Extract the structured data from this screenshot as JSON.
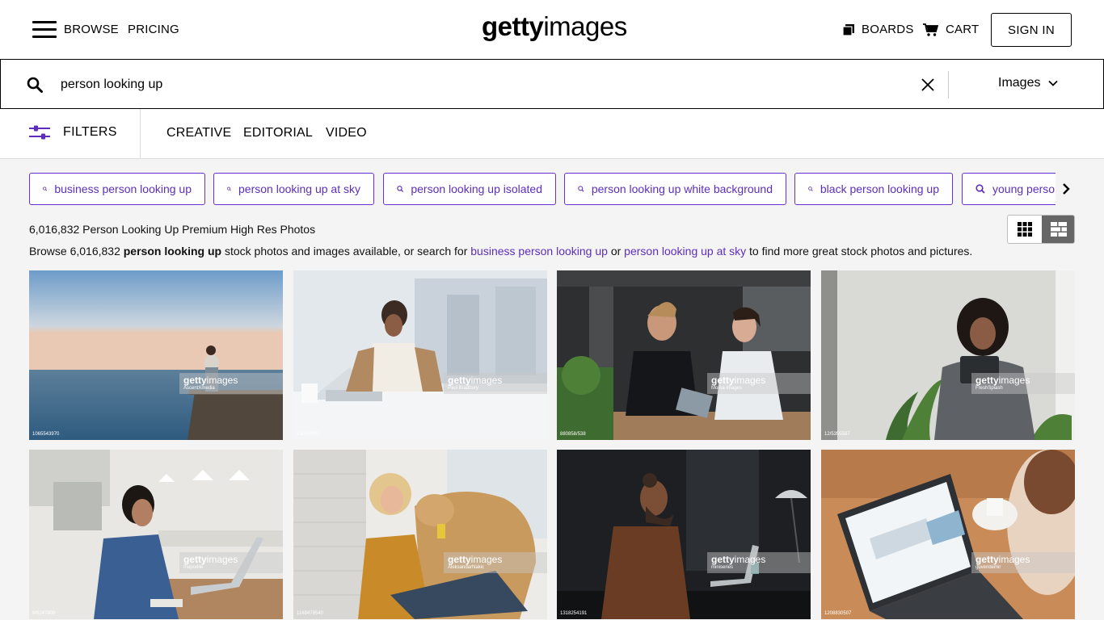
{
  "header": {
    "browse_label": "BROWSE",
    "pricing_label": "PRICING",
    "logo_bold": "getty",
    "logo_light": "images",
    "boards_label": "BOARDS",
    "cart_label": "CART",
    "signin_label": "SIGN IN"
  },
  "search": {
    "query": "person looking up",
    "media_type": "Images"
  },
  "filters": {
    "filters_label": "FILTERS",
    "tabs": [
      "CREATIVE",
      "EDITORIAL",
      "VIDEO"
    ]
  },
  "related_searches": [
    "business person looking up",
    "person looking up at sky",
    "person looking up isolated",
    "person looking up white background",
    "black person looking up",
    "young person looking up"
  ],
  "results": {
    "count_text": "6,016,832 Person Looking Up Premium High Res Photos",
    "browse_prefix": "Browse 6,016,832 ",
    "browse_query": "person looking up",
    "browse_mid": " stock photos and images available, or search for ",
    "link_1": "business person looking up",
    "browse_or": " or ",
    "link_2": "person looking up at sky",
    "browse_suffix": " to find more great stock photos and pictures."
  },
  "watermark": {
    "bold": "getty",
    "light": "images"
  },
  "tiles": [
    {
      "credit": "AscentXmedia",
      "asset_id": "1065543970"
    },
    {
      "credit": "Paul Bradbury",
      "asset_id": "15/850581"
    },
    {
      "credit": "Morsa Images",
      "asset_id": "880858/538"
    },
    {
      "credit": "FreshSplash",
      "asset_id": "12/5355587"
    },
    {
      "credit": "mapodile",
      "asset_id": "8/5247808"
    },
    {
      "credit": "AleksandarNakic",
      "asset_id": "1168478540"
    },
    {
      "credit": "miniseries",
      "asset_id": "1318254191"
    },
    {
      "credit": "guvendemir",
      "asset_id": "1208830507"
    }
  ],
  "colors": {
    "accent_purple": "#6a2fd0",
    "link_purple": "#5d2ebc"
  }
}
